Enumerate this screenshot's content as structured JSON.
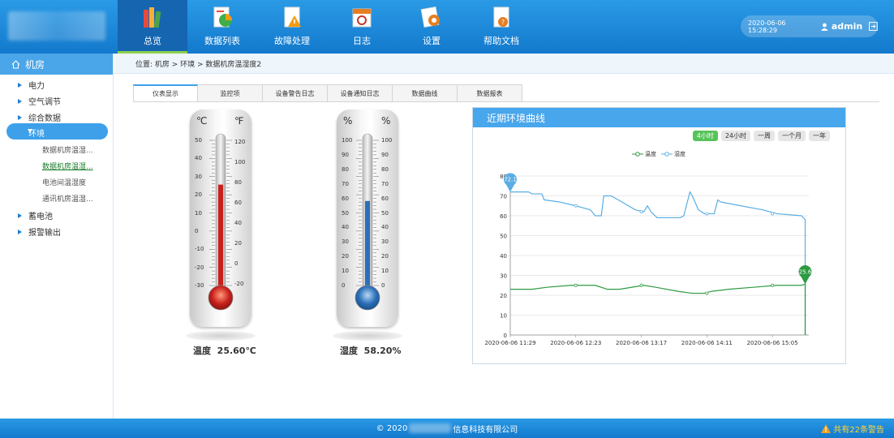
{
  "header": {
    "nav": [
      {
        "label": "总览",
        "icon": "books-icon"
      },
      {
        "label": "数据列表",
        "icon": "report-chart-icon"
      },
      {
        "label": "故障处理",
        "icon": "warning-document-icon"
      },
      {
        "label": "日志",
        "icon": "calendar-icon"
      },
      {
        "label": "设置",
        "icon": "settings-gear-icon"
      },
      {
        "label": "帮助文档",
        "icon": "help-document-icon"
      }
    ],
    "datetime": "2020-06-06  15:28:29",
    "username": "admin"
  },
  "sidebar": {
    "title": "机房",
    "items": [
      {
        "label": "电力"
      },
      {
        "label": "空气调节"
      },
      {
        "label": "综合数据"
      },
      {
        "label": "环境"
      },
      {
        "label": "蓄电池"
      },
      {
        "label": "报警输出"
      }
    ],
    "sub_items": [
      {
        "label": "数据机房温湿..."
      },
      {
        "label": "数据机房温湿..."
      },
      {
        "label": "电池间温湿度"
      },
      {
        "label": "通讯机房温湿..."
      }
    ]
  },
  "breadcrumb": "位置:  机房 > 环境 > 数据机房温湿度2",
  "tabs": [
    "仪表显示",
    "监控项",
    "设备警告日志",
    "设备通知日志",
    "数据曲线",
    "数据报表"
  ],
  "thermometers": {
    "temperature": {
      "unit_left": "℃",
      "unit_right": "℉",
      "left_ticks": [
        "50",
        "40",
        "30",
        "20",
        "10",
        "0",
        "-10",
        "-20",
        "-30"
      ],
      "right_ticks": [
        "120",
        "100",
        "80",
        "60",
        "40",
        "20",
        "0",
        "-20"
      ],
      "label": "温度",
      "value": "25.60℃",
      "fill_celsius": 25.6
    },
    "humidity": {
      "unit_left": "%",
      "unit_right": "%",
      "left_ticks": [
        "100",
        "90",
        "80",
        "70",
        "60",
        "50",
        "40",
        "30",
        "20",
        "10",
        "0"
      ],
      "right_ticks": [
        "100",
        "90",
        "80",
        "70",
        "60",
        "50",
        "40",
        "30",
        "20",
        "10",
        "0"
      ],
      "label": "湿度",
      "value": "58.20%",
      "fill_percent": 58.2
    }
  },
  "chart_panel": {
    "title": "近期环境曲线",
    "ranges": [
      "4小时",
      "24小时",
      "一周",
      "一个月",
      "一年"
    ],
    "active_range": "4小时"
  },
  "chart_data": {
    "type": "line",
    "legend": [
      "温度",
      "湿度"
    ],
    "x_ticks": [
      "2020-06-06 11:29",
      "2020-06-06 12:23",
      "2020-06-06 13:17",
      "2020-06-06 14:11",
      "2020-06-06 15:05"
    ],
    "y_ticks": [
      "0",
      "10",
      "20",
      "30",
      "40",
      "50",
      "60",
      "70",
      "80"
    ],
    "ylim": [
      0,
      80
    ],
    "x_minutes_range": [
      0,
      246
    ],
    "series": [
      {
        "name": "湿度",
        "color": "#5aaee4",
        "marker_label": "72.1",
        "points": [
          [
            0,
            72
          ],
          [
            15,
            72
          ],
          [
            18,
            71
          ],
          [
            26,
            71
          ],
          [
            28,
            68
          ],
          [
            40,
            67
          ],
          [
            54,
            65
          ],
          [
            66,
            63
          ],
          [
            70,
            60
          ],
          [
            75,
            60
          ],
          [
            77,
            70
          ],
          [
            83,
            70
          ],
          [
            89,
            68
          ],
          [
            103,
            63
          ],
          [
            110,
            62
          ],
          [
            113,
            65
          ],
          [
            116,
            62
          ],
          [
            121,
            59
          ],
          [
            140,
            59
          ],
          [
            143,
            60
          ],
          [
            148,
            72
          ],
          [
            150,
            70
          ],
          [
            155,
            63
          ],
          [
            160,
            61
          ],
          [
            168,
            61
          ],
          [
            171,
            68
          ],
          [
            173,
            67
          ],
          [
            190,
            65
          ],
          [
            208,
            63
          ],
          [
            220,
            61
          ],
          [
            240,
            60
          ],
          [
            243,
            58
          ]
        ]
      },
      {
        "name": "温度",
        "color": "#2e9a42",
        "marker_label": "25.6",
        "points": [
          [
            0,
            23
          ],
          [
            18,
            23
          ],
          [
            30,
            24
          ],
          [
            50,
            25
          ],
          [
            70,
            25
          ],
          [
            80,
            23
          ],
          [
            90,
            23
          ],
          [
            110,
            25
          ],
          [
            120,
            24
          ],
          [
            138,
            22
          ],
          [
            150,
            21
          ],
          [
            160,
            21
          ],
          [
            166,
            22
          ],
          [
            180,
            23
          ],
          [
            200,
            24
          ],
          [
            220,
            25
          ],
          [
            240,
            25
          ],
          [
            243,
            25.6
          ]
        ]
      }
    ],
    "drop_to_zero": true
  },
  "footer": {
    "copyright_prefix": "© 2020",
    "copyright_suffix": "信息科技有限公司",
    "alert": "共有22条警告"
  },
  "colors": {
    "header": "#1e88d8",
    "accent": "#3da0e9",
    "temp_mercury": "#c8201c",
    "humidity_fill": "#2a6fb8",
    "active_green": "#57c35a"
  }
}
